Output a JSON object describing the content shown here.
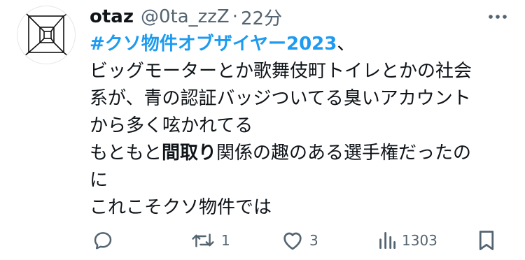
{
  "tweet": {
    "author": {
      "name": "otaz",
      "handle": "@0ta_zzZ",
      "separator": "·",
      "time": "22分"
    },
    "body": {
      "hashtag": "#クソ物件オブザイヤー2023",
      "hashtag_suffix": "、",
      "line2": "ビッグモーターとか歌舞伎町トイレとかの社会",
      "line3": "系が、青の認証バッジついてる臭いアカウント",
      "line4": "から多く呟かれてる",
      "line5_pre": "もともと",
      "line5_bold": "間取り",
      "line5_post": "関係の趣のある選手権だったの",
      "line6": "に",
      "line7": "これこそクソ物件では"
    },
    "actions": {
      "reply_count": "",
      "retweet_count": "1",
      "like_count": "3",
      "views_count": "1303"
    },
    "icons": {
      "more": "more-icon",
      "reply": "reply-icon",
      "retweet": "retweet-icon",
      "like": "heart-icon",
      "views": "views-icon",
      "bookmark": "bookmark-icon"
    },
    "colors": {
      "hashtag": "#1d9bf0",
      "secondary": "#536471",
      "text": "#0f1419"
    }
  }
}
